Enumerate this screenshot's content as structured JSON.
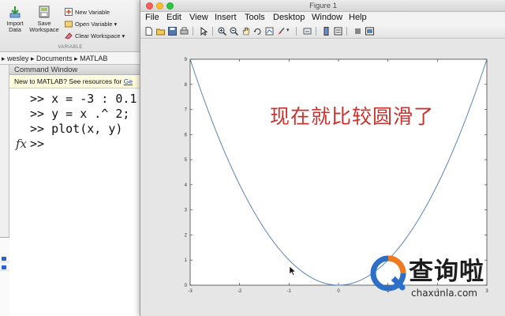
{
  "ribbon": {
    "import_label": "Import\nData",
    "save_label": "Save\nWorkspace",
    "new_variable": "New Variable",
    "open_variable": "Open Variable",
    "clear_workspace": "Clear Workspace",
    "group_label": "VARIABLE"
  },
  "path": {
    "text": "▸ wesley ▸ Documents ▸ MATLAB"
  },
  "command_window": {
    "title": "Command Window",
    "notice_text": "New to MATLAB? See resources for ",
    "notice_link": "Ge",
    "lines": [
      ">> x = -3 : 0.1",
      ">> y = x .^ 2;",
      ">> plot(x, y)",
      ">>"
    ],
    "fx_label": "fx"
  },
  "figure": {
    "title": "Figure 1",
    "menu": [
      "File",
      "Edit",
      "View",
      "Insert",
      "Tools",
      "Desktop",
      "Window",
      "Help"
    ],
    "annotation": "现在就比较圆滑了"
  },
  "watermark": {
    "brand": "查询啦",
    "url": "chaxunla.com"
  },
  "colors": {
    "line": "#5b84b1",
    "annotation": "#c8332f",
    "watermark_orange": "#f07b1e",
    "watermark_blue": "#2d6fc7"
  },
  "chart_data": {
    "type": "line",
    "x_range": [
      -3,
      3
    ],
    "x_step": 0.1,
    "function": "y = x^2",
    "xlim": [
      -3,
      3
    ],
    "ylim": [
      0,
      9
    ],
    "xticks": [
      -3,
      -2,
      -1,
      0,
      1,
      2,
      3
    ],
    "yticks": [
      0,
      1,
      2,
      3,
      4,
      5,
      6,
      7,
      8,
      9
    ],
    "grid": false
  }
}
